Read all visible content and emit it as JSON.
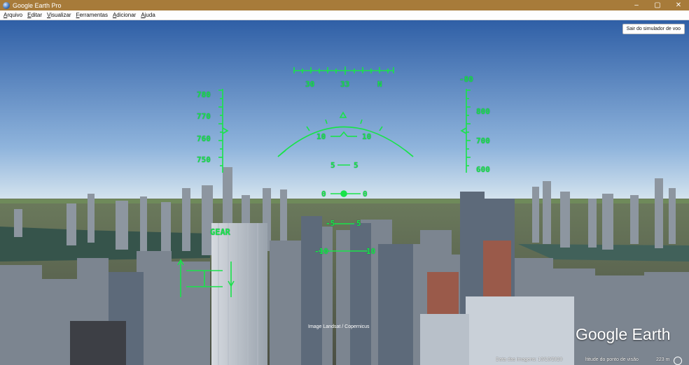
{
  "window": {
    "title": "Google Earth Pro",
    "minimize": "–",
    "maximize": "▢",
    "close": "✕"
  },
  "menu": [
    "Arquivo",
    "Editar",
    "Visualizar",
    "Ferramentas",
    "Adicionar",
    "Ajuda"
  ],
  "exit_button": "Sair do simulador de voo",
  "hud": {
    "heading_labels": [
      "30",
      "33",
      "N"
    ],
    "speed_labels": [
      "780",
      "770",
      "760",
      "750"
    ],
    "altitude_labels": [
      "800",
      "700",
      "600"
    ],
    "vertical_speed": "-80",
    "pitch_labels": [
      "10",
      "10",
      "5",
      "5",
      "0",
      "0",
      "-5",
      "5",
      "-10",
      "10"
    ],
    "gear": "GEAR"
  },
  "attribution": "Image Landsat / Copernicus",
  "brand": "Google Earth",
  "footer": {
    "imagery_date": "Data das imagens: 10/10/2020",
    "eye_altitude": "ltitude do ponto de visão",
    "altitude_value": "223 m"
  },
  "colors": {
    "hud": "#19e34a",
    "titlebar": "#a77b3a",
    "sky_top": "#2f5fa6"
  }
}
